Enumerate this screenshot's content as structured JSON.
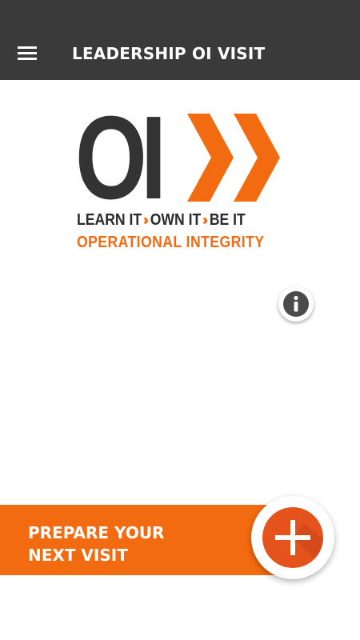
{
  "header": {
    "title": "LEADERSHIP OI VISIT",
    "menu_icon": "hamburger-menu-icon",
    "background": "#3a3a3a"
  },
  "logo": {
    "mark": "OI",
    "tagline": [
      "LEARN IT",
      "OWN IT",
      "BE IT"
    ],
    "tagline_separator": "››",
    "subtitle": "OPERATIONAL INTEGRITY",
    "accent": "#f26b10",
    "dark": "#333333"
  },
  "info_button": {
    "icon": "info-icon"
  },
  "cta": {
    "line1": "PREPARE YOUR",
    "line2": "NEXT VISIT",
    "icon": "plus-icon",
    "bar_color": "#f36b10",
    "button_color": "#e4531b"
  }
}
